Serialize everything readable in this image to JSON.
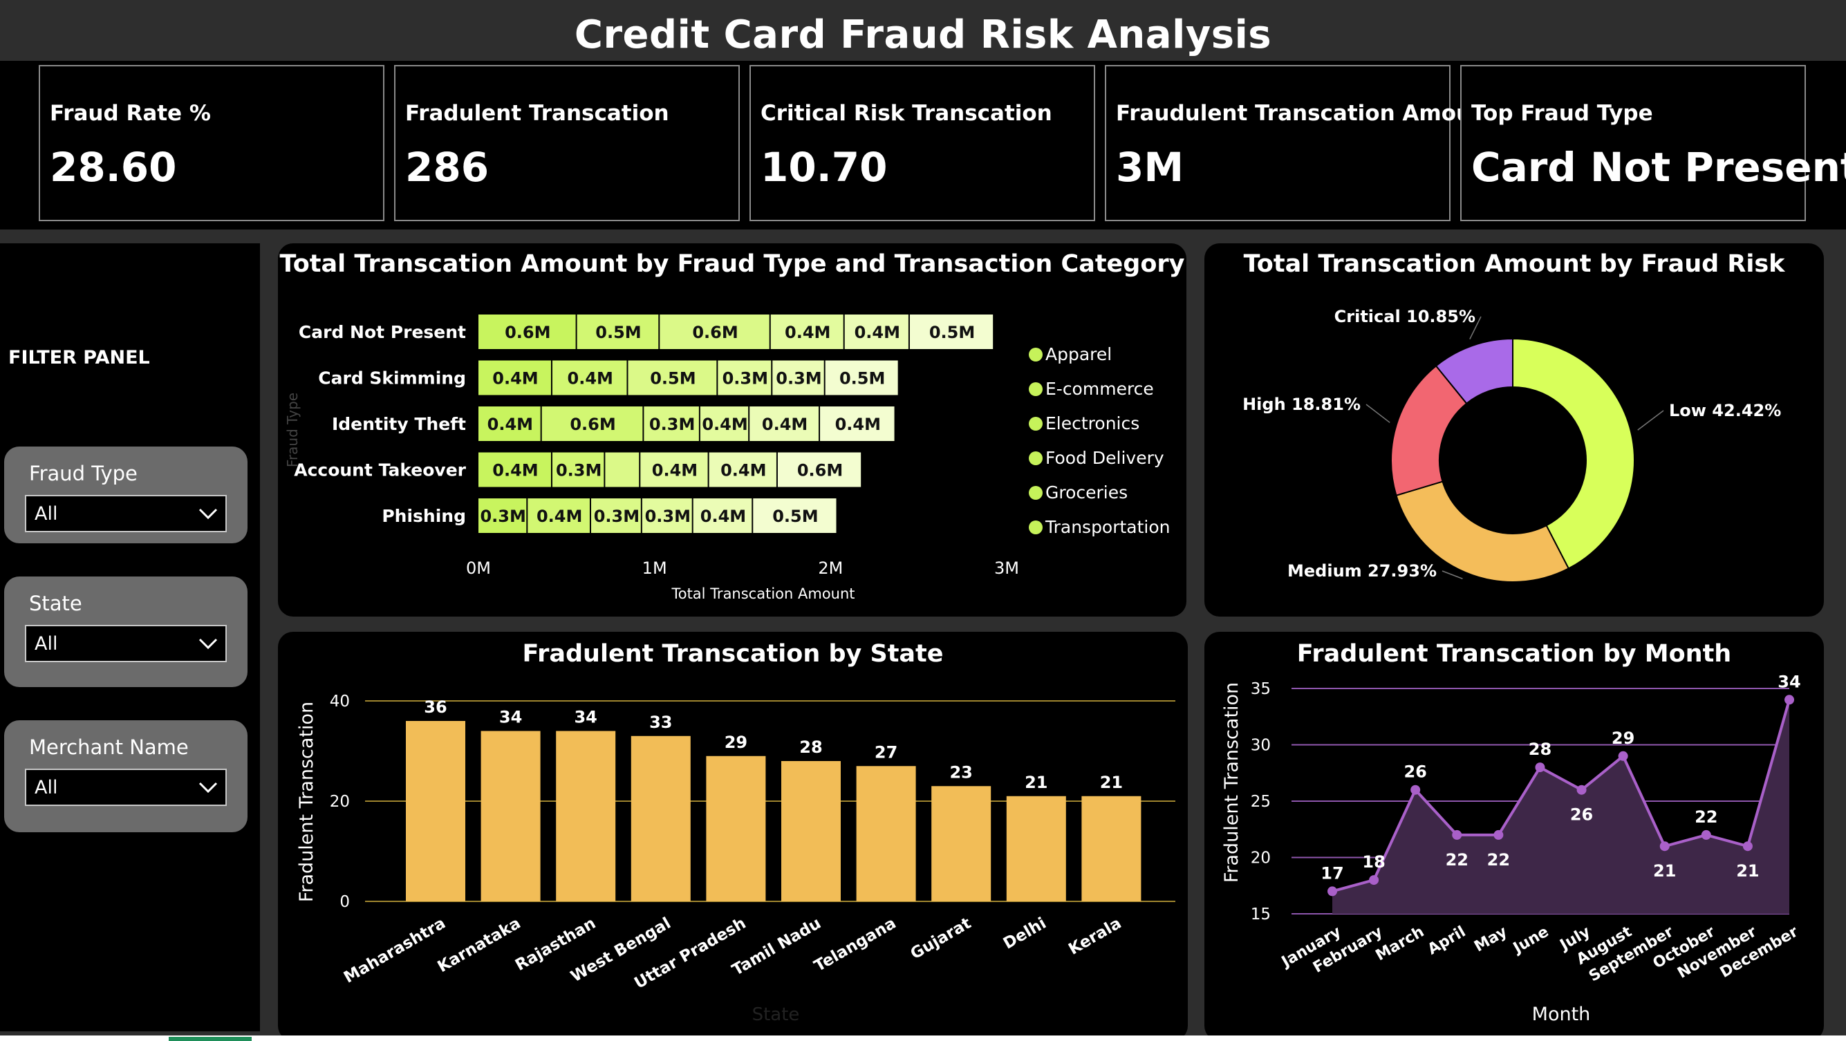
{
  "title": "Credit Card Fraud Risk Analysis",
  "kpis": [
    {
      "label": "Fraud Rate %",
      "value": "28.60"
    },
    {
      "label": "Fradulent Transcation",
      "value": "286"
    },
    {
      "label": "Critical Risk Transcation",
      "value": "10.70"
    },
    {
      "label": "Fraudulent Transcation Amount",
      "value": "3M"
    },
    {
      "label": "Top Fraud Type",
      "value": "Card Not Present"
    }
  ],
  "filters": {
    "title": "FILTER PANEL",
    "slicers": [
      {
        "label": "Fraud Type",
        "value": "All"
      },
      {
        "label": "State",
        "value": "All"
      },
      {
        "label": "Merchant Name",
        "value": "All"
      }
    ]
  },
  "colors": {
    "accent_bar": "#f2bd57",
    "line": "#a960c9",
    "line_fill": "#3e2748",
    "grid_bar": "#d4b13e",
    "grid_line": "#8e56ad",
    "donut_low": "#d8ff5a",
    "donut_medium": "#f4bd5a",
    "donut_high": "#f26671",
    "donut_critical": "#a96ae8",
    "stack_shades": [
      "#c8f45e",
      "#d2f772",
      "#dbf988",
      "#e3fb9e",
      "#ebfcb6",
      "#f3fdd0"
    ]
  },
  "chart_data": [
    {
      "id": "stacked",
      "type": "bar",
      "title": "Total Transcation Amount by Fraud Type and Transaction Category",
      "xlabel": "Total Transcation Amount",
      "ylabel": "Fraud Type",
      "orientation": "horizontal",
      "stacked": true,
      "xlim": [
        0,
        3
      ],
      "xticks": [
        "0M",
        "1M",
        "2M",
        "3M"
      ],
      "categories": [
        "Card Not Present",
        "Card Skimming",
        "Identity Theft",
        "Account Takeover",
        "Phishing"
      ],
      "series": [
        {
          "name": "Apparel",
          "values": [
            0.56,
            0.42,
            0.36,
            0.42,
            0.28
          ]
        },
        {
          "name": "E-commerce",
          "values": [
            0.47,
            0.43,
            0.58,
            0.3,
            0.36
          ]
        },
        {
          "name": "Electronics",
          "values": [
            0.63,
            0.51,
            0.32,
            0.2,
            0.29
          ]
        },
        {
          "name": "Food Delivery",
          "values": [
            0.42,
            0.31,
            0.28,
            0.39,
            0.29
          ]
        },
        {
          "name": "Groceries",
          "values": [
            0.37,
            0.3,
            0.4,
            0.39,
            0.34
          ]
        },
        {
          "name": "Transportation",
          "values": [
            0.48,
            0.42,
            0.43,
            0.48,
            0.48
          ]
        }
      ],
      "bar_labels": [
        [
          "0.6M",
          "0.5M",
          "0.6M",
          "0.4M",
          "0.4M",
          "0.5M"
        ],
        [
          "0.4M",
          "0.4M",
          "0.5M",
          "0.3M",
          "0.3M",
          "0.5M"
        ],
        [
          "0.4M",
          "0.6M",
          "0.3M",
          "0.4M",
          "0.4M",
          "0.4M"
        ],
        [
          "0.4M",
          "0.3M",
          "",
          "0.4M",
          "0.4M",
          "0.6M"
        ],
        [
          "0.3M",
          "0.4M",
          "0.3M",
          "0.3M",
          "0.4M",
          "0.5M"
        ]
      ],
      "legend": "right"
    },
    {
      "id": "donut",
      "type": "pie",
      "title": "Total Transcation Amount by Fraud Risk",
      "slices": [
        {
          "name": "Low",
          "value": 42.42,
          "label": "Low 42.42%"
        },
        {
          "name": "Medium",
          "value": 27.93,
          "label": "Medium 27.93%"
        },
        {
          "name": "High",
          "value": 18.81,
          "label": "High 18.81%"
        },
        {
          "name": "Critical",
          "value": 10.85,
          "label": "Critical 10.85%"
        }
      ]
    },
    {
      "id": "state",
      "type": "bar",
      "title": "Fradulent Transcation by State",
      "xlabel": "State",
      "ylabel": "Fradulent Transcation",
      "ylim": [
        0,
        40
      ],
      "yticks": [
        "0",
        "20",
        "40"
      ],
      "categories": [
        "Maharashtra",
        "Karnataka",
        "Rajasthan",
        "West Bengal",
        "Uttar Pradesh",
        "Tamil Nadu",
        "Telangana",
        "Gujarat",
        "Delhi",
        "Kerala"
      ],
      "values": [
        36,
        34,
        34,
        33,
        29,
        28,
        27,
        23,
        21,
        21
      ],
      "grid": true
    },
    {
      "id": "month",
      "type": "area",
      "title": "Fradulent Transcation by Month",
      "xlabel": "Month",
      "ylabel": "Fradulent Transcation",
      "ylim": [
        15,
        35
      ],
      "yticks": [
        "15",
        "20",
        "25",
        "30",
        "35"
      ],
      "categories": [
        "January",
        "February",
        "March",
        "April",
        "May",
        "June",
        "July",
        "August",
        "September",
        "October",
        "November",
        "December"
      ],
      "values": [
        17,
        18,
        26,
        22,
        22,
        28,
        26,
        29,
        21,
        22,
        21,
        34
      ],
      "grid": true
    }
  ]
}
